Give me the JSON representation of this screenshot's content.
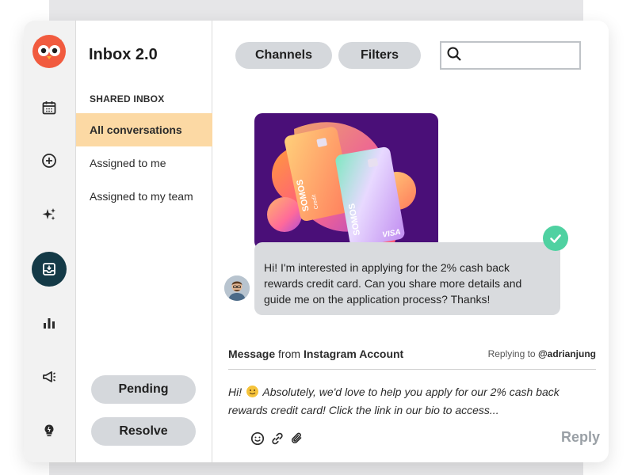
{
  "app": {
    "title": "Inbox 2.0"
  },
  "rail": {
    "items": [
      {
        "icon": "calendar-icon"
      },
      {
        "icon": "plus-circle-icon"
      },
      {
        "icon": "sparkles-icon"
      },
      {
        "icon": "inbox-icon",
        "active": true
      },
      {
        "icon": "bar-chart-icon"
      },
      {
        "icon": "megaphone-icon"
      },
      {
        "icon": "lightbulb-icon"
      }
    ]
  },
  "sidebar": {
    "section_label": "SHARED INBOX",
    "items": [
      {
        "label": "All conversations",
        "active": true
      },
      {
        "label": "Assigned to me"
      },
      {
        "label": "Assigned to my team"
      }
    ],
    "pending_label": "Pending",
    "resolve_label": "Resolve"
  },
  "toolbar": {
    "channels_label": "Channels",
    "filters_label": "Filters",
    "search_placeholder": ""
  },
  "conversation": {
    "card_brand": "SOMOS",
    "card_sub": "Credit",
    "card_network": "VISA",
    "message": "Hi! I'm interested in applying for the 2% cash back rewards credit card. Can you share more details and guide me on the application process? Thanks!",
    "status_icon": "check-icon"
  },
  "composer": {
    "header_prefix": "Message",
    "header_from": "from",
    "header_account": "Instagram Account",
    "replying_prefix": "Replying to",
    "replying_handle": "@adrianjung",
    "draft_greeting": "Hi!",
    "draft_body": "Absolutely, we'd love to help you apply for our 2% cash back rewards credit card! Click the link in our bio to access...",
    "reply_label": "Reply"
  },
  "colors": {
    "accent_active": "#fcd9a4",
    "rail_active": "#143a47",
    "success": "#4fd1a1",
    "card_bg": "#4a0f78"
  }
}
